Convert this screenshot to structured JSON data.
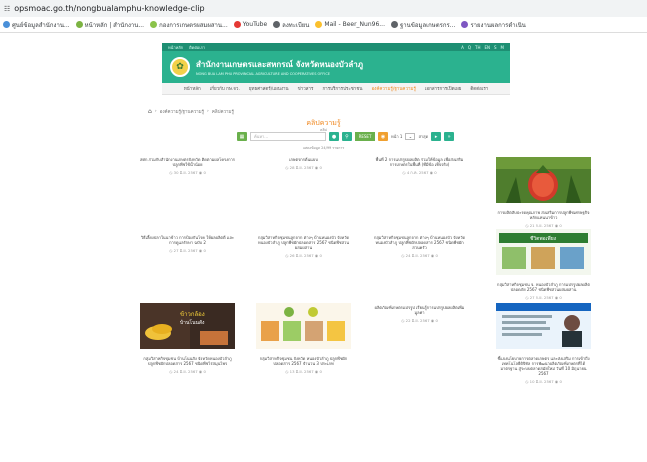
{
  "browser": {
    "url": "opsmoac.go.th/nongbualamphu-knowledge-clip",
    "bookmarks": [
      {
        "label": "ศูนย์ข้อมูลสำนักงาน...",
        "color": "#4a90d9"
      },
      {
        "label": "หน้าหลัก | สำนักงาน...",
        "color": "#7cb342"
      },
      {
        "label": "กองการเกษตรผสมผสาน...",
        "color": "#8bc34a"
      },
      {
        "label": "YouTube",
        "color": "#e53935"
      },
      {
        "label": "ลงทะเบียน",
        "color": "#5f6368"
      },
      {
        "label": "Mail - Beer_Nun96...",
        "color": "#fbc02d"
      },
      {
        "label": "ฐานข้อมูลเกษตรกร...",
        "color": "#5f6368"
      },
      {
        "label": "รายงานผลการดำเนิน",
        "color": "#7e57c2"
      }
    ]
  },
  "site": {
    "topbar_left": [
      "หน้าหลัก",
      "ติดต่อเรา"
    ],
    "topbar_right": [
      "A",
      "Q",
      "TH",
      "EN",
      "S",
      "M"
    ],
    "title": "สำนักงานเกษตรและสหกรณ์ จังหวัดหนองบัวลำภู",
    "subtitle": "NONG BUA LAM PHU PROVINCIAL AGRICULTURE AND COOPERATIVES OFFICE",
    "nav": [
      {
        "label": "หน้าหลัก",
        "active": false
      },
      {
        "label": "เกี่ยวกับ กษ.จว.",
        "active": false
      },
      {
        "label": "ยุทธศาสตร์/แผนงาน",
        "active": false
      },
      {
        "label": "ข่าวสาร",
        "active": false
      },
      {
        "label": "การบริการประชาชน",
        "active": false
      },
      {
        "label": "องค์ความรู้/ฐานความรู้",
        "active": true
      },
      {
        "label": "เอกสารการเปิดเผย",
        "active": false
      },
      {
        "label": "ติดต่อเรา",
        "active": false
      }
    ]
  },
  "breadcrumb": {
    "home_icon": "home-icon",
    "items": [
      "องค์ความรู้/ฐานความรู้",
      "คลิปความรู้"
    ]
  },
  "page": {
    "heading": "คลิปความรู้",
    "subheading": "คลิป",
    "search_placeholder": "ค้นหา...",
    "reset_label": "RESET",
    "per_page_label": "หน้า 1",
    "per_page_value": "1",
    "sort_label": "ล่าสุด",
    "result_text": "แสดงข้อมูล 24/99 รายการ"
  },
  "cards": [
    {
      "title": "สศก.ร่วมกับสำนักงานเกษตรจังหวัด ติดตามผลโครงการ ปลูกพืชใช้น้ำน้อย",
      "date": "30 มิ.ย. 2567",
      "views": "0",
      "has_thumb": false
    },
    {
      "title": "เกษตรกรต้นแบบ",
      "date": "28 มิ.ย. 2567",
      "views": "0",
      "has_thumb": false
    },
    {
      "title": "พื้นที่ 2 การแปรรูปผลผลิต ร่วมให้ข้อมูล เพื่อส่งเสริม การเกษตรในพื้นที่ (ที่มีข้อ เท็จจริง)",
      "date": "4 ก.ค. 2567",
      "views": "0",
      "has_thumb": false
    },
    {
      "title": "การผลิตสับปะรดคุณภาพ ส่งเสริมการปลูกพืชเศรษฐกิจหลักแทนนาข้าว",
      "date": "21 ก.ย. 2567",
      "views": "0",
      "has_thumb": true,
      "thumb": "pineapple"
    },
    {
      "title": "วิธีเลี้ยงปลาในนาข้าว การป้องกันโรค ให้ผลผลิตดี และการดูแลรักษา ฉบับ 2",
      "date": "27 มิ.ย. 2567",
      "views": "0",
      "has_thumb": false
    },
    {
      "title": "กลุ่มวิสาหกิจชุมชนลูกจาก ต่างๆ บ้านหนองบัว จังหวัดหนองบัวลำภู ปลูกพืชผักปลอดสาร 2567 ชนิดพืชสวนผสมผสาน",
      "date": "26 มิ.ย. 2567",
      "views": "0",
      "has_thumb": false
    },
    {
      "title": "กลุ่มวิสาหกิจชุมชนลูกจาก ต่างๆ บ้านหนองบัว จังหวัดหนองบัวลำภู ปลูกพืชผักปลอดสาร 2567 ชนิดพืชผักสวนครัว",
      "date": "24 มิ.ย. 2567",
      "views": "0",
      "has_thumb": false
    },
    {
      "title": "กลุ่มวิสาหกิจชุมชน จ. หนองบัวลำภู การแปรรูปผลผลิต ปลอดภัย 2567 ชนิดพืชสวนผสมผสาน",
      "date": "27 ก.ย. 2567",
      "views": "0",
      "has_thumb": true,
      "thumb": "banner"
    },
    {
      "title": "กลุ่มวิสาหกิจชุมชน บ้านโนนสัง จังหวัดหนองบัวลำภู ปลูกพืชผักปลอดสาร 2567 ชนิดพืชไร่สมุนไพร",
      "date": "24 มิ.ย. 2567",
      "views": "0",
      "has_thumb": true,
      "thumb": "bananas"
    },
    {
      "title": "กลุ่มวิสาหกิจชุมชน จังหวัด หนองบัวลำภู ปลูกพืชผักปลอดสาร 2567 จำนวน 3 ประเภท",
      "date": "13 มิ.ย. 2567",
      "views": "0",
      "has_thumb": true,
      "thumb": "produce"
    },
    {
      "title": "ผลิตภัณฑ์เกษตรแปรรูป เรียนรู้การแปรรูปผลผลิตเพิ่มมูลค่า",
      "date": "22 มิ.ย. 2567",
      "views": "0",
      "has_thumb": false
    },
    {
      "title": "ชี้แจงนโยบายการตลาดเกษตร และส่งเสริม การเข้าถึงเทคโนโลยีดิจิทัล การพัฒนาผลิตภัณฑ์เกษตรที่ได้มาตรฐาน สู่ระบบตลาดสมัยใหม่ วันที่ 10 มิถุนายน 2567",
      "date": "10 มิ.ย. 2567",
      "views": "0",
      "has_thumb": true,
      "thumb": "poster"
    }
  ],
  "icons": {
    "date": "clock-icon",
    "views": "eye-icon"
  }
}
